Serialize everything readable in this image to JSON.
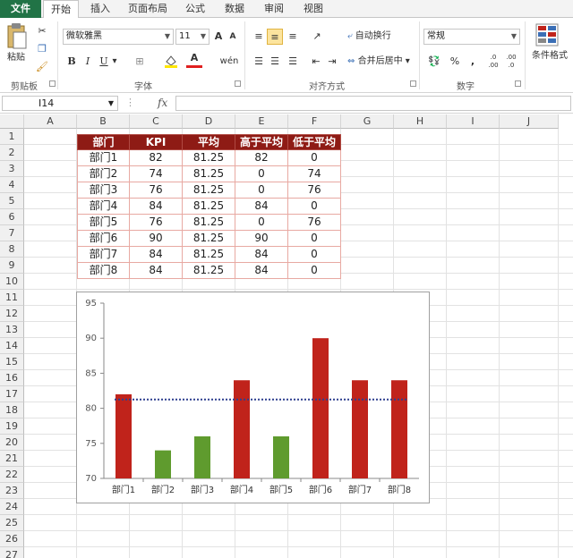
{
  "ribbon": {
    "tabs": [
      "文件",
      "开始",
      "插入",
      "页面布局",
      "公式",
      "数据",
      "审阅",
      "视图"
    ],
    "active_tab": "开始",
    "clipboard": {
      "paste": "粘贴",
      "group": "剪贴板"
    },
    "font": {
      "name": "微软雅黑",
      "size": "11",
      "group": "字体",
      "bold": "B",
      "italic": "I",
      "underline": "U",
      "grow": "A",
      "shrink": "A",
      "font_color": "A",
      "wen": "wén"
    },
    "alignment": {
      "wrap": "自动换行",
      "merge": "合并后居中",
      "group": "对齐方式"
    },
    "number": {
      "format": "常规",
      "percent": "%",
      "comma": ",",
      "inc": ".0 .00",
      "dec": ".00 .0",
      "group": "数字"
    },
    "styles": {
      "conditional": "条件格式"
    }
  },
  "formula_bar": {
    "name_box": "I14",
    "fx": "fx",
    "value": ""
  },
  "columns": [
    "A",
    "B",
    "C",
    "D",
    "E",
    "F",
    "G",
    "H",
    "I",
    "J"
  ],
  "rows": [
    "1",
    "2",
    "3",
    "4",
    "5",
    "6",
    "7",
    "8",
    "9",
    "10",
    "11",
    "12",
    "13",
    "14",
    "15",
    "16",
    "17",
    "18",
    "19",
    "20",
    "21",
    "22",
    "23",
    "24",
    "25",
    "26",
    "27"
  ],
  "table": {
    "headers": [
      "部门",
      "KPI",
      "平均",
      "高于平均",
      "低于平均"
    ],
    "rows": [
      [
        "部门1",
        "82",
        "81.25",
        "82",
        "0"
      ],
      [
        "部门2",
        "74",
        "81.25",
        "0",
        "74"
      ],
      [
        "部门3",
        "76",
        "81.25",
        "0",
        "76"
      ],
      [
        "部门4",
        "84",
        "81.25",
        "84",
        "0"
      ],
      [
        "部门5",
        "76",
        "81.25",
        "0",
        "76"
      ],
      [
        "部门6",
        "90",
        "81.25",
        "90",
        "0"
      ],
      [
        "部门7",
        "84",
        "81.25",
        "84",
        "0"
      ],
      [
        "部门8",
        "84",
        "81.25",
        "84",
        "0"
      ]
    ]
  },
  "colors": {
    "above": "#c0231b",
    "below": "#5f9b2e",
    "average": "#2e3f8f",
    "header": "#8e1b15"
  },
  "chart_data": {
    "type": "bar",
    "categories": [
      "部门1",
      "部门2",
      "部门3",
      "部门4",
      "部门5",
      "部门6",
      "部门7",
      "部门8"
    ],
    "series": [
      {
        "values": [
          82,
          0,
          0,
          84,
          0,
          90,
          84,
          84
        ]
      },
      {
        "values": [
          0,
          74,
          76,
          0,
          76,
          0,
          0,
          0
        ]
      }
    ],
    "average": 81.25,
    "yticks": [
      "70",
      "75",
      "80",
      "85",
      "90",
      "95"
    ],
    "ylim": [
      70,
      95
    ],
    "grid": false,
    "legend": "none"
  }
}
